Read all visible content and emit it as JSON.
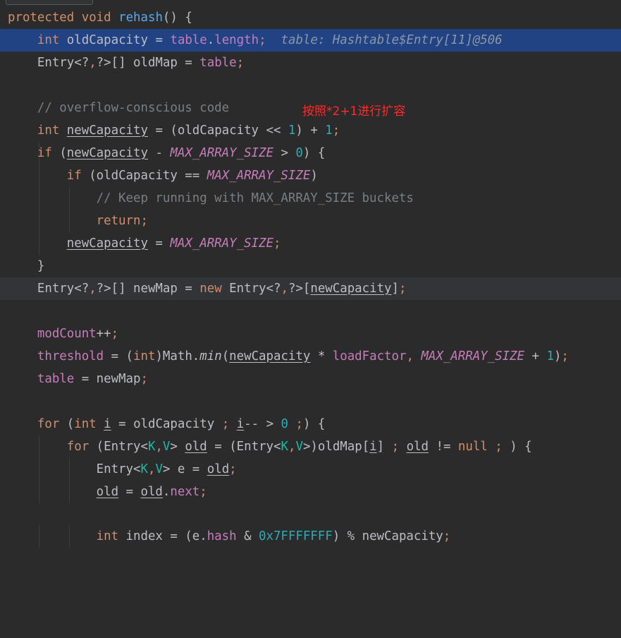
{
  "editor": {
    "inline_hint": "table: Hashtable$Entry[11]@506",
    "annotation": "按照*2+1进行扩容",
    "colors": {
      "background": "#2b2b2b",
      "highlight_line": "#214283",
      "keyword": "#cf8e6d",
      "function": "#56a8f5",
      "field": "#c77dbb",
      "number": "#2aacb8",
      "comment": "#7a7e85",
      "annotation": "#ff2a2a"
    }
  },
  "code": {
    "l0": {
      "kw1": "protected",
      "kw2": "void",
      "fn": "rehash",
      "rest": "() {"
    },
    "l1": {
      "kw": "int",
      "var": "oldCapacity",
      "eq": " = ",
      "obj": "table",
      "dot": ".",
      "prop": "length",
      "semi": ";"
    },
    "l2": {
      "a": "Entry<?",
      "comma": ",",
      "b": "?>[] oldMap = ",
      "obj": "table",
      "semi": ";"
    },
    "l4": {
      "comment": "// overflow-conscious code"
    },
    "l5": {
      "kw": "int",
      "var": "newCapacity",
      "a": " = (oldCapacity << ",
      "n1": "1",
      "b": ") + ",
      "n2": "1",
      "semi": ";"
    },
    "l6": {
      "kw": "if",
      "a": " (",
      "var": "newCapacity",
      "b": " - ",
      "cst": "MAX_ARRAY_SIZE",
      "c": " > ",
      "n": "0",
      "d": ") {"
    },
    "l7": {
      "kw": "if",
      "a": " (oldCapacity == ",
      "cst": "MAX_ARRAY_SIZE",
      "b": ")"
    },
    "l8": {
      "comment": "// Keep running with MAX_ARRAY_SIZE buckets"
    },
    "l9": {
      "kw": "return",
      "semi": ";"
    },
    "l10": {
      "var": "newCapacity",
      "a": " = ",
      "cst": "MAX_ARRAY_SIZE",
      "semi": ";"
    },
    "l11": {
      "brace": "}"
    },
    "l12": {
      "a": "Entry<?",
      "c1": ",",
      "b": "?>[] newMap = ",
      "kw": "new",
      "c": " Entry<?",
      "c2": ",",
      "d": "?>[",
      "var": "newCapacity",
      "e": "]",
      "semi": ";"
    },
    "l14": {
      "fld": "modCount",
      "a": "++",
      "semi": ";"
    },
    "l15": {
      "fld": "threshold",
      "a": " = (",
      "kw": "int",
      "b": ")Math.",
      "m": "min",
      "c": "(",
      "var": "newCapacity",
      "d": " * ",
      "lf": "loadFactor",
      "cm": ", ",
      "cst": "MAX_ARRAY_SIZE",
      "e": " + ",
      "n": "1",
      "f": ")",
      "semi": ";"
    },
    "l16": {
      "fld": "table",
      "a": " = newMap",
      "semi": ";"
    },
    "l18": {
      "kw": "for",
      "a": " (",
      "kw2": "int",
      "b": " ",
      "i": "i",
      "c": " = oldCapacity ",
      "s1": ";",
      "d": " ",
      "i2": "i",
      "e": "-- > ",
      "n": "0",
      "f": " ",
      "s2": ";",
      "g": ") {"
    },
    "l19": {
      "kw": "for",
      "a": " (Entry<",
      "k": "K",
      "cm": ",",
      "v": "V",
      "b": "> ",
      "old": "old",
      "c": " = (Entry<",
      "k2": "K",
      "cm2": ",",
      "v2": "V",
      "d": ">)oldMap[",
      "i": "i",
      "e": "] ",
      "s1": ";",
      "f": " ",
      "old2": "old",
      "g": " != ",
      "nul": "null",
      "h": " ",
      "s2": ";",
      "j": " ) {"
    },
    "l20": {
      "a": "Entry<",
      "k": "K",
      "cm": ",",
      "v": "V",
      "b": "> e = ",
      "old": "old",
      "semi": ";"
    },
    "l21": {
      "old": "old",
      "a": " = ",
      "old2": "old",
      "dot": ".",
      "nxt": "next",
      "semi": ";"
    },
    "l23": {
      "kw": "int",
      "a": " index = (e.",
      "h": "hash",
      "b": " & ",
      "hx": "0x7FFFFFFF",
      "c": ") % newCapacity",
      "semi": ";"
    }
  }
}
